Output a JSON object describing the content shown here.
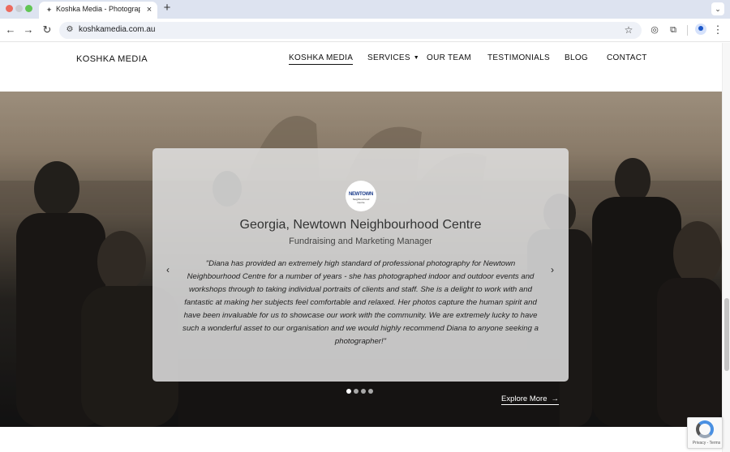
{
  "browser": {
    "tab_title": "Koshka Media - Photography",
    "tab_close": "×",
    "new_tab": "+",
    "url": "koshkamedia.com.au"
  },
  "nav": {
    "brand": "KOSHKA MEDIA",
    "items": [
      {
        "label": "KOSHKA MEDIA",
        "active": true
      },
      {
        "label": "SERVICES",
        "dropdown": true
      },
      {
        "label": "OUR TEAM"
      },
      {
        "label": "TESTIMONIALS"
      },
      {
        "label": "BLOG"
      },
      {
        "label": "CONTACT"
      }
    ]
  },
  "testimonial": {
    "logo_text": "NEWTOWN",
    "logo_subtext": "Neighbourhood Centre",
    "name": "Georgia, Newtown Neighbourhood Centre",
    "role": "Fundraising and Marketing Manager",
    "quote": "\"Diana has provided an extremely high standard of professional photography for Newtown Neighbourhood Centre for a number of years - she has photographed indoor and outdoor events and workshops through to taking individual portraits of clients and staff. She is a delight to work with and fantastic at making her subjects feel comfortable and relaxed. Her photos capture the human spirit and have been invaluable for us to showcase our work with the community. We are extremely lucky to have such a wonderful asset to our organisation and we would highly recommend Diana to anyone seeking a photographer!\"",
    "prev": "‹",
    "next": "›",
    "slides_total": 4,
    "active_slide": 1
  },
  "explore": {
    "label": "Explore More",
    "arrow": "→"
  },
  "recaptcha": {
    "text": "Privacy - Terms"
  }
}
